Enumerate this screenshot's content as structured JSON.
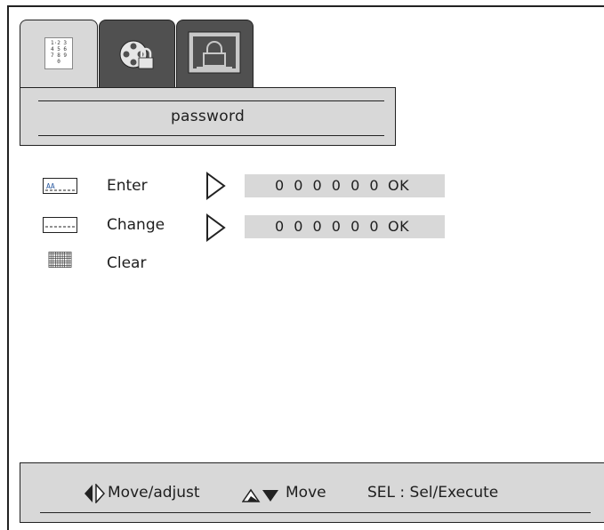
{
  "tabs": [
    {
      "icon": "keypad-icon",
      "active": true
    },
    {
      "icon": "film-reel-lock-icon",
      "active": false
    },
    {
      "icon": "tv-lock-icon",
      "active": false
    }
  ],
  "keypad": {
    "row1": "1·2 3",
    "row2": "4 5 6",
    "row3": "7 8 9",
    "row4": "0"
  },
  "title": "password",
  "rows": [
    {
      "label": "Enter",
      "icon": "enter-code-icon",
      "icon_text": "AA",
      "value": "0 0 0 0 0 0",
      "ok": "OK"
    },
    {
      "label": "Change",
      "icon": "change-code-icon",
      "value": "0 0 0 0 0 0",
      "ok": "OK"
    },
    {
      "label": "Clear",
      "icon": "clear-grid-icon"
    }
  ],
  "footer": {
    "move_adjust": "Move/adjust",
    "move": "Move",
    "sel": "SEL : Sel/Execute"
  },
  "colors": {
    "panel": "#d8d8d8",
    "tab_dark": "#505050",
    "ink": "#1e1e1e"
  }
}
